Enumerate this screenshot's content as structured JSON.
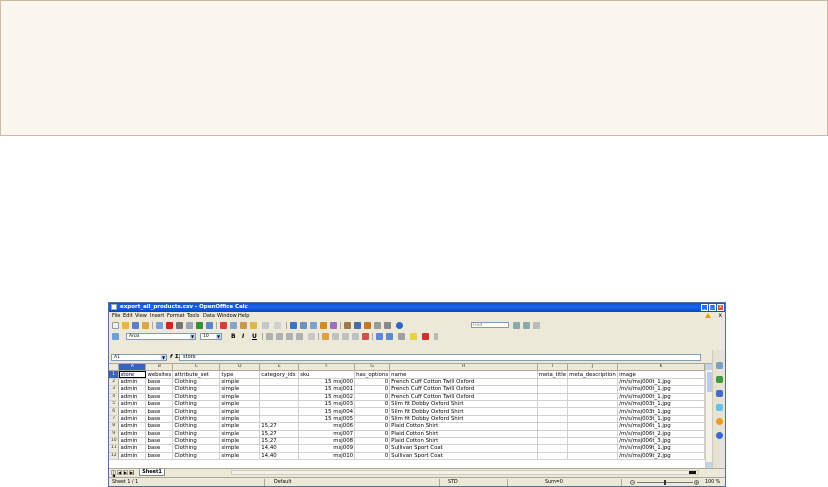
{
  "window": {
    "title": "export_all_products.csv - OpenOffice Calc",
    "controls": [
      "_",
      "□",
      "x"
    ]
  },
  "menubar": {
    "items": [
      "File",
      "Edit",
      "View",
      "Insert",
      "Format",
      "Tools",
      "Data",
      "Window",
      "Help"
    ],
    "close": "x"
  },
  "toolbar": {
    "find_placeholder": "Find",
    "font_name": "Arial",
    "font_size": "10",
    "bold": "B",
    "italic": "I",
    "underline": "U"
  },
  "formula_bar": {
    "cell_ref": "A1",
    "func_label": "f",
    "sum_label": "Σ",
    "equals_label": "=",
    "value": "store"
  },
  "sheet": {
    "columns": [
      "A",
      "B",
      "C",
      "D",
      "E",
      "F",
      "G",
      "H",
      "I",
      "J",
      "K"
    ],
    "rows": [
      {
        "n": "1",
        "cells": [
          "store",
          "websites",
          "attribute_set",
          "type",
          "category_ids",
          "sku",
          "has_options",
          "name",
          "meta_title",
          "meta_description",
          "image"
        ]
      },
      {
        "n": "2",
        "cells": [
          "admin",
          "base",
          "Clothing",
          "simple",
          "",
          "15 msj000",
          "0",
          "French Cuff Cotton Twill Oxford",
          "",
          "",
          "/m/s/msj000t_1.jpg"
        ]
      },
      {
        "n": "3",
        "cells": [
          "admin",
          "base",
          "Clothing",
          "simple",
          "",
          "15 msj001",
          "0",
          "French Cuff Cotton Twill Oxford",
          "",
          "",
          "/m/s/msj000t_1.jpg"
        ]
      },
      {
        "n": "4",
        "cells": [
          "admin",
          "base",
          "Clothing",
          "simple",
          "",
          "15 msj002",
          "0",
          "French Cuff Cotton Twill Oxford",
          "",
          "",
          "/m/s/msj000t_1.jpg"
        ]
      },
      {
        "n": "5",
        "cells": [
          "admin",
          "base",
          "Clothing",
          "simple",
          "",
          "15 msj003",
          "0",
          "Slim fit Dobby Oxford Shirt",
          "",
          "",
          "/m/s/msj003t_1.jpg"
        ]
      },
      {
        "n": "6",
        "cells": [
          "admin",
          "base",
          "Clothing",
          "simple",
          "",
          "15 msj004",
          "0",
          "Slim fit Dobby Oxford Shirt",
          "",
          "",
          "/m/s/msj003t_1.jpg"
        ]
      },
      {
        "n": "7",
        "cells": [
          "admin",
          "base",
          "Clothing",
          "simple",
          "",
          "15 msj005",
          "0",
          "Slim fit Dobby Oxford Shirt",
          "",
          "",
          "/m/s/msj003t_1.jpg"
        ]
      },
      {
        "n": "8",
        "cells": [
          "admin",
          "base",
          "Clothing",
          "simple",
          "15,27",
          "msj006",
          "0",
          "Plaid Cotton Shirt",
          "",
          "",
          "/m/s/msj006t_1.jpg"
        ]
      },
      {
        "n": "9",
        "cells": [
          "admin",
          "base",
          "Clothing",
          "simple",
          "15,27",
          "msj007",
          "0",
          "Plaid Cotton Shirt",
          "",
          "",
          "/m/s/msj006t_2.jpg"
        ]
      },
      {
        "n": "10",
        "cells": [
          "admin",
          "base",
          "Clothing",
          "simple",
          "15,27",
          "msj008",
          "0",
          "Plaid Cotton Shirt",
          "",
          "",
          "/m/s/msj006t_3.jpg"
        ]
      },
      {
        "n": "11",
        "cells": [
          "admin",
          "base",
          "Clothing",
          "simple",
          "14,40",
          "msj009",
          "0",
          "Sullivan Sport Coat",
          "",
          "",
          "/m/s/msj009t_1.jpg"
        ]
      },
      {
        "n": "12",
        "cells": [
          "admin",
          "base",
          "Clothing",
          "simple",
          "14,40",
          "msj010",
          "0",
          "Sullivan Sport Coat",
          "",
          "",
          "/m/s/msj009t_2.jpg"
        ]
      }
    ]
  },
  "tabs": {
    "nav": [
      "|◀",
      "◀",
      "▶",
      "▶|"
    ],
    "sheet_name": "Sheet1"
  },
  "status": {
    "sheet": "Sheet 1 / 1",
    "style": "Default",
    "mode": "STD",
    "sum": "Sum=0",
    "zoom": "100 %",
    "zoom_minus": "−",
    "zoom_plus": "+"
  },
  "colors": {
    "title_bar": "#1b64e8",
    "selection": "#3a63b3",
    "banner_bg": "#fbf6ee"
  }
}
